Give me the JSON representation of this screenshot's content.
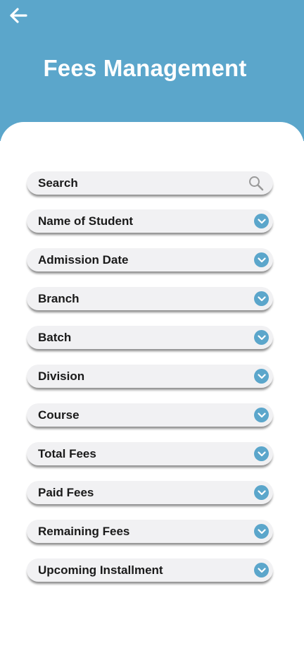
{
  "header": {
    "title": "Fees Management",
    "back_icon": "arrow-left-icon",
    "background_color": "#5ba6cb"
  },
  "search": {
    "label": "Search",
    "icon": "search-icon"
  },
  "fields": [
    {
      "label": "Name of Student",
      "icon": "chevron-down-icon"
    },
    {
      "label": "Admission Date",
      "icon": "chevron-down-icon"
    },
    {
      "label": "Branch",
      "icon": "chevron-down-icon"
    },
    {
      "label": "Batch",
      "icon": "chevron-down-icon"
    },
    {
      "label": "Division",
      "icon": "chevron-down-icon"
    },
    {
      "label": "Course",
      "icon": "chevron-down-icon"
    },
    {
      "label": "Total Fees",
      "icon": "chevron-down-icon"
    },
    {
      "label": "Paid Fees",
      "icon": "chevron-down-icon"
    },
    {
      "label": "Remaining Fees",
      "icon": "chevron-down-icon"
    },
    {
      "label": "Upcoming Installment",
      "icon": "chevron-down-icon"
    }
  ]
}
